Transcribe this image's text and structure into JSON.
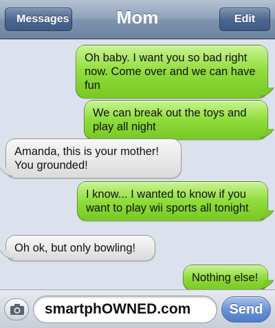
{
  "navbar": {
    "back_label": "Messages",
    "title": "Mom",
    "edit_label": "Edit"
  },
  "messages": [
    {
      "side": "sent",
      "text": "Oh baby. I want you so bad right now. Come over and we can have fun"
    },
    {
      "side": "sent",
      "text": "We can break out the toys and play all night"
    },
    {
      "side": "received",
      "text": "Amanda, this is your mother! You grounded!"
    },
    {
      "side": "sent",
      "text": "I know... I wanted to know if you want to play wii sports all tonight"
    },
    {
      "side": "received",
      "text": "Oh ok, but only bowling!"
    },
    {
      "side": "sent",
      "text": "Nothing else!"
    }
  ],
  "input": {
    "camera_icon": "camera-icon",
    "text_value": "smartphOWNED.com",
    "send_label": "Send"
  },
  "colors": {
    "sent_bubble": "#8fdc3a",
    "received_bubble": "#e8e8e8",
    "background": "#dbe2ed",
    "send_button": "#6b93d6"
  }
}
